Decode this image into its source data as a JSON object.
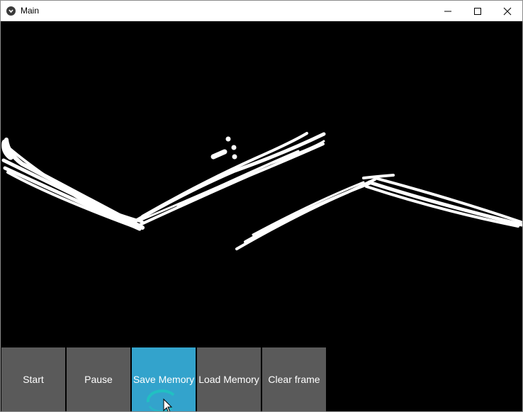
{
  "window": {
    "title": "Main",
    "controls": {
      "minimize_icon": "minimize-icon",
      "maximize_icon": "maximize-icon",
      "close_icon": "close-icon"
    }
  },
  "canvas": {
    "background": "#000000",
    "stroke_color": "#ffffff"
  },
  "toolbar": {
    "buttons": [
      {
        "label": "Start"
      },
      {
        "label": "Pause"
      },
      {
        "label": "Save Memory"
      },
      {
        "label": "Load Memory"
      },
      {
        "label": "Clear frame"
      }
    ],
    "button_color": "#5a5a5a",
    "active_button_color": "#33a3cc",
    "text_color": "#ffffff"
  }
}
